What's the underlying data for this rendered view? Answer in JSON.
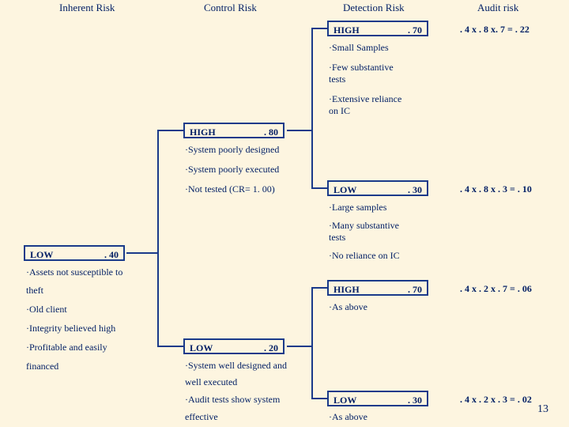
{
  "headers": {
    "inherent": "Inherent Risk",
    "control": "Control Risk",
    "detect": "Detection Risk",
    "audit": "Audit risk"
  },
  "ir_low": {
    "label": "LOW",
    "val": ". 40"
  },
  "ir_n1": "·Assets not susceptible to",
  "ir_n2": "theft",
  "ir_n3": "·Old client",
  "ir_n4": "·Integrity believed high",
  "ir_n5": "·Profitable and easily",
  "ir_n6": "financed",
  "cr_high": {
    "label": "HIGH",
    "val": ". 80"
  },
  "cr_h1": "·System poorly designed",
  "cr_h2": "·System poorly executed",
  "cr_h3": "·Not tested (CR= 1. 00)",
  "cr_low": {
    "label": "LOW",
    "val": ". 20"
  },
  "cr_l1": "·System well designed and",
  "cr_l2": "well executed",
  "cr_l3": "·Audit tests show system",
  "cr_l4": "effective",
  "dr1": {
    "label": "HIGH",
    "val": ". 70"
  },
  "dr1_n1": "·Small Samples",
  "dr1_n2": "·Few substantive",
  "dr1_n2b": "tests",
  "dr1_n3": "·Extensive reliance",
  "dr1_n3b": "on IC",
  "dr2": {
    "label": "LOW",
    "val": ". 30"
  },
  "dr2_n1": "·Large samples",
  "dr2_n2": "·Many substantive",
  "dr2_n2b": "tests",
  "dr2_n3": "·No reliance on IC",
  "dr3": {
    "label": "HIGH",
    "val": ". 70"
  },
  "dr3_n1": "·As above",
  "dr4": {
    "label": "LOW",
    "val": ". 30"
  },
  "dr4_n1": "·As above",
  "a1": ". 4 x . 8 x. 7 = . 22",
  "a2": ". 4 x . 8 x . 3 = . 10",
  "a3": ". 4 x . 2 x . 7 = . 06",
  "a4": ". 4 x . 2 x . 3 = . 02",
  "pagenum": "13",
  "chart_data": {
    "type": "table",
    "title": "Audit risk = Inherent × Control × Detection",
    "columns": [
      "Inherent Risk",
      "Control Risk",
      "Detection Risk",
      "Audit risk"
    ],
    "rows": [
      {
        "IR": 0.4,
        "CR": 0.8,
        "DR": 0.7,
        "AR": 0.22
      },
      {
        "IR": 0.4,
        "CR": 0.8,
        "DR": 0.3,
        "AR": 0.1
      },
      {
        "IR": 0.4,
        "CR": 0.2,
        "DR": 0.7,
        "AR": 0.06
      },
      {
        "IR": 0.4,
        "CR": 0.2,
        "DR": 0.3,
        "AR": 0.02
      }
    ]
  }
}
